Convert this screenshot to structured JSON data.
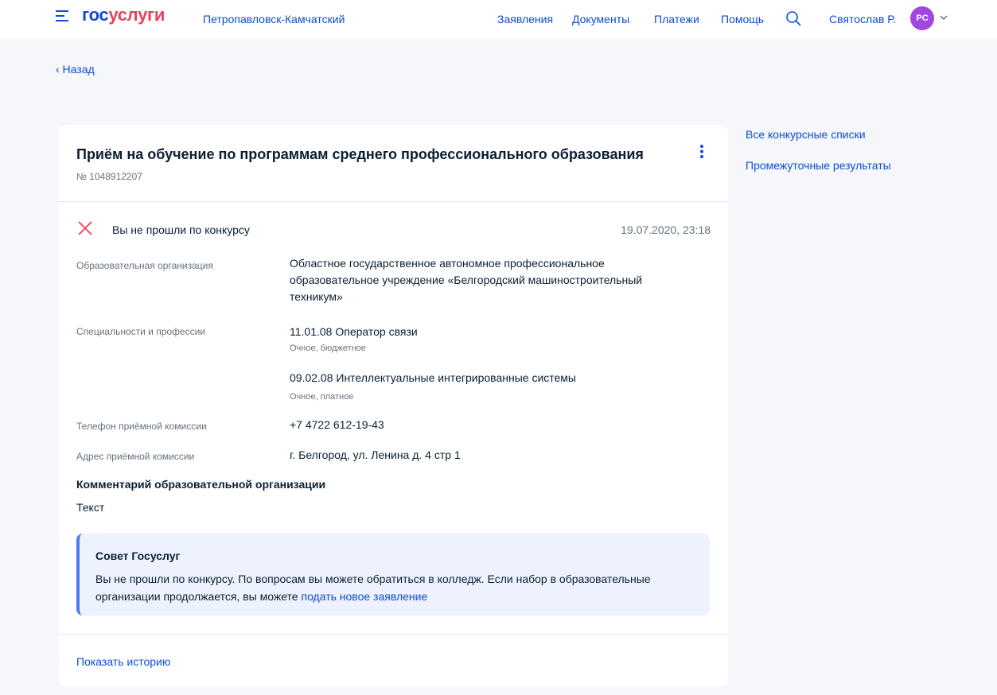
{
  "header": {
    "logo_part1": "гос",
    "logo_part2": "услуги",
    "city": "Петропавловск-Камчатский",
    "nav": [
      "Заявления",
      "Документы",
      "Платежи",
      "Помощь"
    ],
    "user_name": "Святослав Р.",
    "avatar_initials": "PC",
    "icons": [
      "menu-icon",
      "search-icon",
      "chevron-down-icon"
    ]
  },
  "back_link": "‹ Назад",
  "application": {
    "title": "Приём на обучение по программам среднего профессионального образования",
    "number": "№ 1048912207",
    "status_text": "Вы не прошли по конкурсу",
    "status_date": "19.07.2020, 23:18",
    "org_label": "Образовательная организация",
    "org_value": "Областное государственное автономное профессиональное образовательное учреждение «Белгородский машиностроительный техникум»",
    "specs_label": "Специальности и  профессии",
    "specs": [
      {
        "name": "11.01.08 Оператор связи",
        "details": "Очное, бюджетное"
      },
      {
        "name": "09.02.08 Интеллектуальные интегрированные системы",
        "details": "Очное, платное"
      }
    ],
    "phone_label": "Телефон приёмной комиссии",
    "phone_value": "+7 4722 612-19-43",
    "address_label": "Адрес приёмной комиссии",
    "address_value": "г. Белгород, ул. Ленина д. 4 стр 1",
    "comment_title": "Комментарий образовательной организации",
    "comment_text": "Текст",
    "tip_title": "Совет Госуслуг",
    "tip_text": "Вы не прошли по конкурсу. По вопросам вы можете обратиться в колледж. Если набор в образовательные организации продолжается, вы можете ",
    "tip_link": "подать новое заявление",
    "history_link": "Показать историю"
  },
  "sidebar": {
    "links": [
      "Все конкурсные списки",
      "Промежуточные результаты"
    ]
  },
  "colors": {
    "accent": "#0d4cd3",
    "brand_red": "#ee3f58",
    "error": "#ee3f58",
    "avatar": "#a146e0",
    "tip_background": "#edf2fe"
  }
}
